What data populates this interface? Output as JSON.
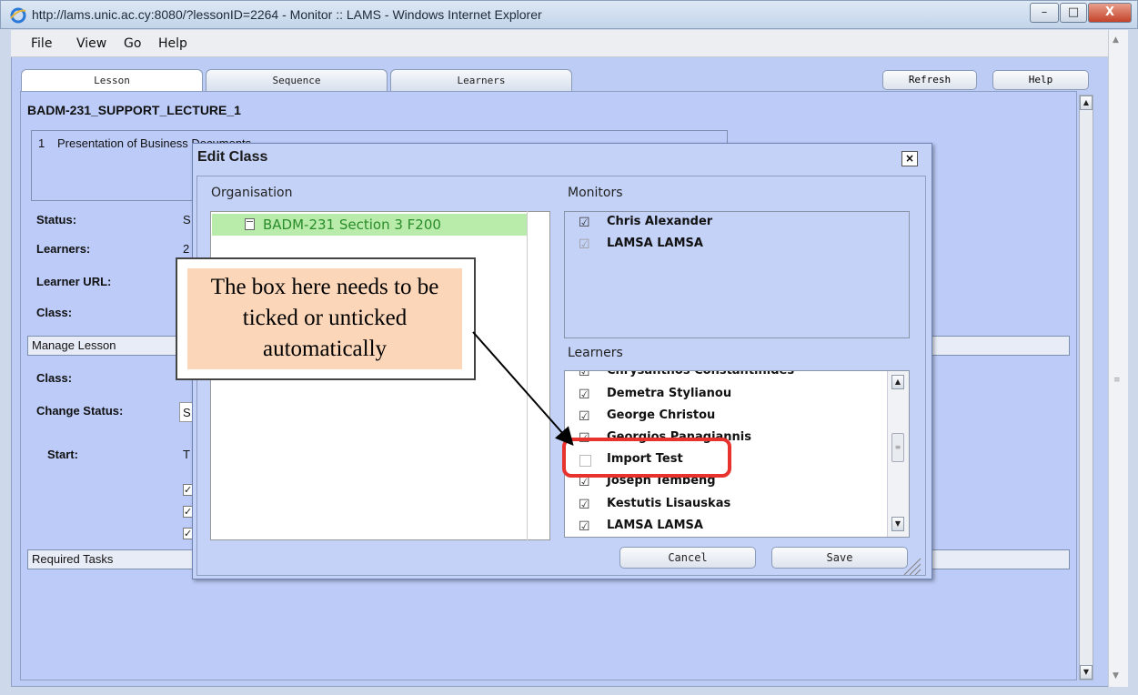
{
  "window": {
    "title": "http://lams.unic.ac.cy:8080/?lessonID=2264 - Monitor :: LAMS - Windows Internet Explorer",
    "minimize": "–",
    "maximize": "□",
    "close": "X"
  },
  "menu": [
    "File",
    "View",
    "Go",
    "Help"
  ],
  "tabs": [
    "Lesson",
    "Sequence",
    "Learners"
  ],
  "top_buttons": {
    "refresh": "Refresh",
    "help": "Help"
  },
  "lesson": {
    "title": "BADM-231_SUPPORT_LECTURE_1",
    "activity_num": "1",
    "activity_name": "Presentation of Business Documents",
    "status_label": "Status:",
    "status_value": "S",
    "learners_label": "Learners:",
    "learners_value": "2",
    "learner_url_label": "Learner URL:",
    "class_label": "Class:",
    "manage_lesson": "Manage Lesson",
    "class2_label": "Class:",
    "change_status_label": "Change Status:",
    "change_status_value": "S",
    "start_label": "Start:",
    "start_value": "T",
    "required_tasks": "Required Tasks"
  },
  "dialog": {
    "title": "Edit Class",
    "close": "×",
    "organisation_label": "Organisation",
    "organisation_item": "BADM-231 Section 3 F200",
    "monitors_label": "Monitors",
    "monitors": [
      {
        "name": "Chris Alexander",
        "checked": true
      },
      {
        "name": "LAMSA LAMSA",
        "checked": true
      }
    ],
    "learners_label": "Learners",
    "learners": [
      {
        "name": "Chrysanthos Constantinides",
        "checked": true
      },
      {
        "name": "Demetra Stylianou",
        "checked": true
      },
      {
        "name": "George Christou",
        "checked": true
      },
      {
        "name": "Georgios Panagiannis",
        "checked": true
      },
      {
        "name": "Import Test",
        "checked": false
      },
      {
        "name": "Joseph Tembeng",
        "checked": true
      },
      {
        "name": "Kestutis Lisauskas",
        "checked": true
      },
      {
        "name": "LAMSA LAMSA",
        "checked": true
      }
    ],
    "cancel": "Cancel",
    "save": "Save"
  },
  "callout": {
    "text": "The box here needs to be ticked or unticked automatically"
  },
  "colors": {
    "highlight_red": "#e8322e",
    "org_row_green": "#b9ecaa",
    "panel_blue": "#bccbf7"
  }
}
